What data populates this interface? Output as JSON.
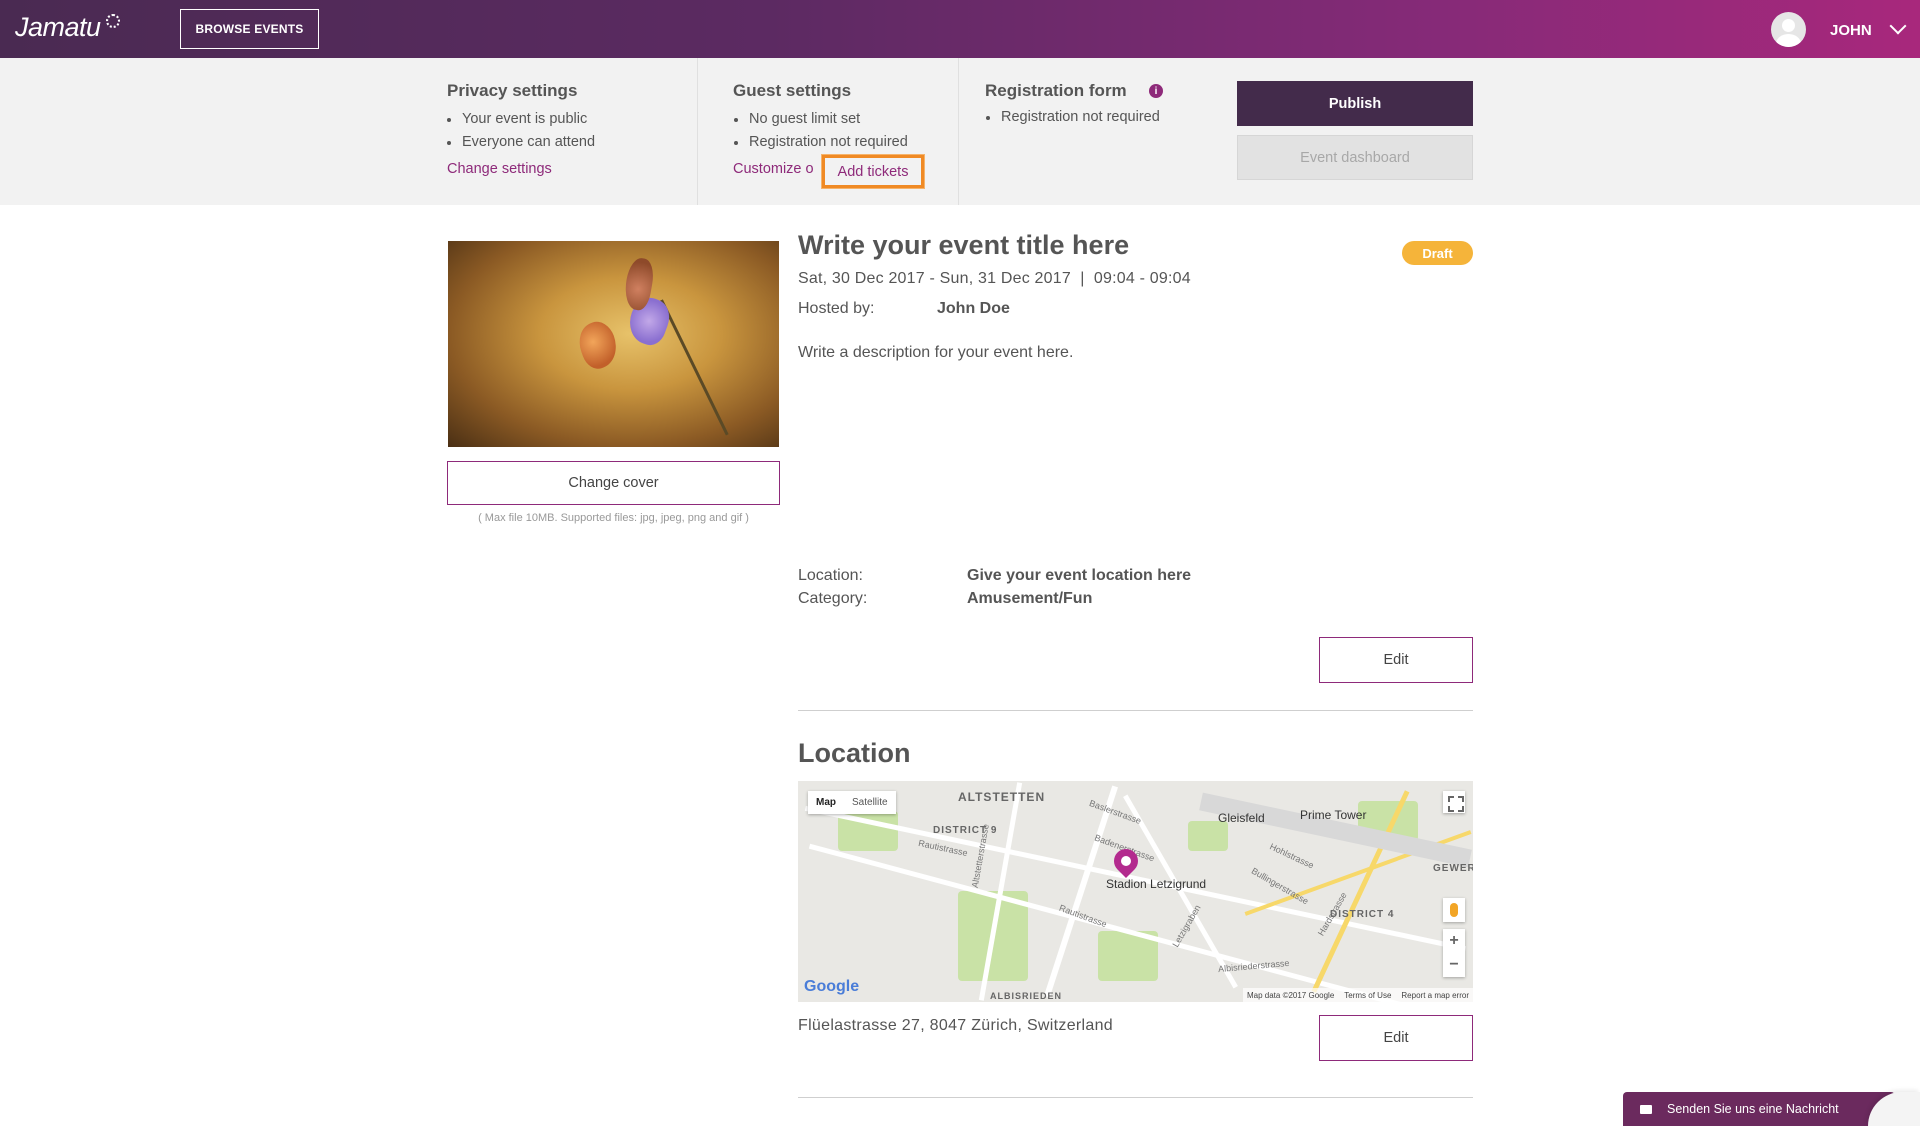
{
  "header": {
    "logo": "Jamatu",
    "browse_label": "BROWSE EVENTS",
    "user_name": "JOHN"
  },
  "privacy": {
    "title": "Privacy settings",
    "items": [
      "Your event is public",
      "Everyone can attend"
    ],
    "link": "Change settings"
  },
  "guest": {
    "title": "Guest settings",
    "items": [
      "No guest limit set",
      "Registration not required"
    ],
    "link_partial": "Customize o",
    "add_tickets": "Add tickets"
  },
  "registration": {
    "title": "Registration form",
    "info_glyph": "i",
    "items": [
      "Registration not required"
    ]
  },
  "actions": {
    "publish": "Publish",
    "dashboard": "Event dashboard"
  },
  "cover": {
    "change_label": "Change cover",
    "hint": "( Max file 10MB. Supported files: jpg, jpeg, png and gif )"
  },
  "event": {
    "title": "Write your event title here",
    "status": "Draft",
    "date": "Sat, 30 Dec 2017 - Sun, 31 Dec 2017  |  09:04 - 09:04",
    "hosted_label": "Hosted by:",
    "host": "John Doe",
    "description": "Write a description for your event here.",
    "location_label": "Location:",
    "location_value": "Give your event location here",
    "category_label": "Category:",
    "category_value": "Amusement/Fun",
    "edit_label": "Edit"
  },
  "location_section": {
    "title": "Location",
    "address": "Flüelastrasse 27, 8047 Zürich, Switzerland",
    "edit_label": "Edit",
    "map": {
      "type_map": "Map",
      "type_satellite": "Satellite",
      "labels": {
        "altstetten": "ALTSTETTEN",
        "district9": "DISTRICT 9",
        "district4": "DISTRICT 4",
        "gleisfeld": "Gleisfeld",
        "prime_tower": "Prime Tower",
        "stadion": "Stadion Letzigrund",
        "gewer": "GEWER",
        "albisrieden": "ALBISRIEDEN",
        "badenerstrasse": "Badenerstrasse",
        "rautistrasse": "Rautistrasse",
        "hohlstrasse": "Hohlstrasse",
        "baslerstrasse": "Baslerstrasse",
        "letzigraben": "Letzigraben",
        "albisriederstrasse": "Albisriederstrasse",
        "bullingerstrasse": "Bullingerstrasse",
        "hardstrasse": "Hardstrasse",
        "altstetterstrasse": "Altstetterstrasse"
      },
      "zoom_in": "+",
      "zoom_out": "−",
      "google": "Google",
      "footer": [
        "Map data ©2017 Google",
        "Terms of Use",
        "Report a map error"
      ]
    }
  },
  "chat": {
    "label": "Senden Sie uns eine Nachricht"
  }
}
